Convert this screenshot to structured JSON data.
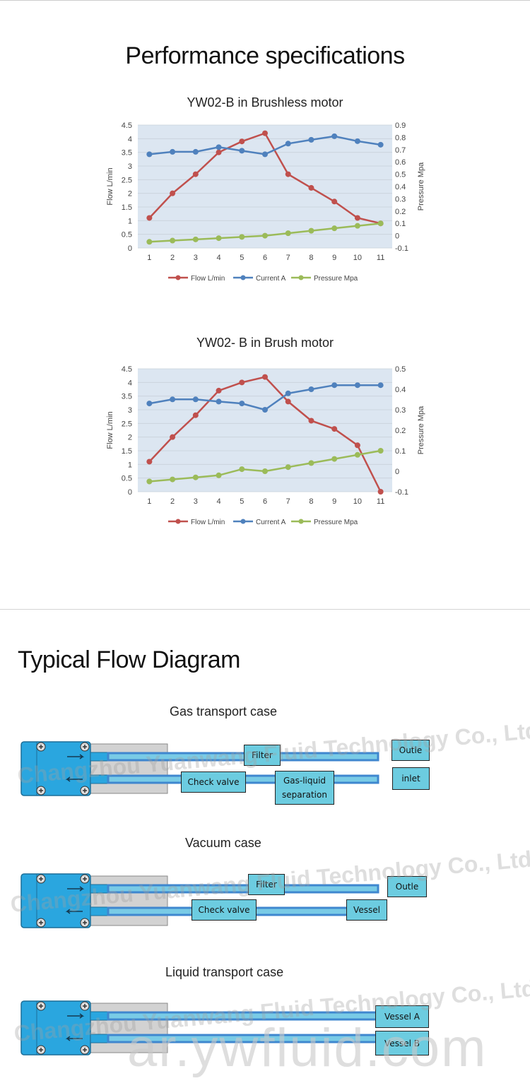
{
  "page": {
    "title": "Performance specifications",
    "section2_title": "Typical Flow Diagram",
    "watermark_company": "Changzhou Yuanwang Fluid Technology Co., Ltd",
    "watermark_site": "ar.ywfluid.com"
  },
  "chart_data": [
    {
      "type": "line",
      "title": "YW02-B in Brushless motor",
      "x": [
        1,
        2,
        3,
        4,
        5,
        6,
        7,
        8,
        9,
        10,
        11
      ],
      "ylabel": "Flow  L/min",
      "y2label": "Pressure  Mpa",
      "ylim": [
        0,
        4.5
      ],
      "y2lim": [
        -0.1,
        0.9
      ],
      "yticks": [
        "0",
        "0.5",
        "1",
        "1.5",
        "2",
        "2.5",
        "3",
        "3.5",
        "4",
        "4.5"
      ],
      "y2ticks": [
        "-0.1",
        "0",
        "0.1",
        "0.2",
        "0.3",
        "0.4",
        "0.5",
        "0.6",
        "0.7",
        "0.8",
        "0.9"
      ],
      "grid": true,
      "legend": "bottom",
      "series": [
        {
          "name": "Flow L/min",
          "axis": "left",
          "color": "#c0504d",
          "values": [
            1.1,
            2.0,
            2.7,
            3.5,
            3.9,
            4.2,
            2.7,
            2.2,
            1.7,
            1.1,
            0.9
          ]
        },
        {
          "name": "Current A",
          "axis": "left",
          "color": "#4f81bd",
          "values": [
            3.43,
            3.52,
            3.52,
            3.69,
            3.56,
            3.43,
            3.82,
            3.96,
            4.09,
            3.91,
            3.78
          ]
        },
        {
          "name": "Pressure Mpa",
          "axis": "right",
          "color": "#9bbb59",
          "values": [
            -0.05,
            -0.04,
            -0.03,
            -0.02,
            -0.01,
            0.0,
            0.02,
            0.04,
            0.06,
            0.08,
            0.1
          ]
        }
      ]
    },
    {
      "type": "line",
      "title": "YW02- B in Brush motor",
      "x": [
        1,
        2,
        3,
        4,
        5,
        6,
        7,
        8,
        9,
        10,
        11
      ],
      "ylabel": "Flow  L/min",
      "y2label": "Pressure  Mpa",
      "ylim": [
        0,
        4.5
      ],
      "y2lim": [
        -0.1,
        0.5
      ],
      "yticks": [
        "0",
        "0.5",
        "1",
        "1.5",
        "2",
        "2.5",
        "3",
        "3.5",
        "4",
        "4.5"
      ],
      "y2ticks": [
        "-0.1",
        "0",
        "0.1",
        "0.2",
        "0.3",
        "0.4",
        "0.5"
      ],
      "grid": true,
      "legend": "bottom",
      "series": [
        {
          "name": "Flow L/min",
          "axis": "left",
          "color": "#c0504d",
          "values": [
            1.1,
            2.0,
            2.8,
            3.7,
            4.0,
            4.2,
            3.3,
            2.6,
            2.3,
            1.7,
            0.0
          ]
        },
        {
          "name": "Current A",
          "axis": "left",
          "color": "#4f81bd",
          "values": [
            3.23,
            3.38,
            3.38,
            3.3,
            3.23,
            3.0,
            3.6,
            3.75,
            3.9,
            3.9,
            3.9
          ]
        },
        {
          "name": "Pressure Mpa",
          "axis": "right",
          "color": "#9bbb59",
          "values": [
            -0.05,
            -0.04,
            -0.03,
            -0.02,
            0.01,
            0.0,
            0.02,
            0.04,
            0.06,
            0.08,
            0.1
          ]
        }
      ]
    }
  ],
  "flow_cases": [
    {
      "title": "Gas transport case",
      "labels": [
        "Filter",
        "Check valve",
        "Gas-liquid separation",
        "Outle",
        "inlet"
      ]
    },
    {
      "title": "Vacuum case",
      "labels": [
        "Filter",
        "Check valve",
        "Outle",
        "Vessel"
      ]
    },
    {
      "title": "Liquid transport case",
      "labels": [
        "Vessel A",
        "Vessel B"
      ]
    }
  ]
}
